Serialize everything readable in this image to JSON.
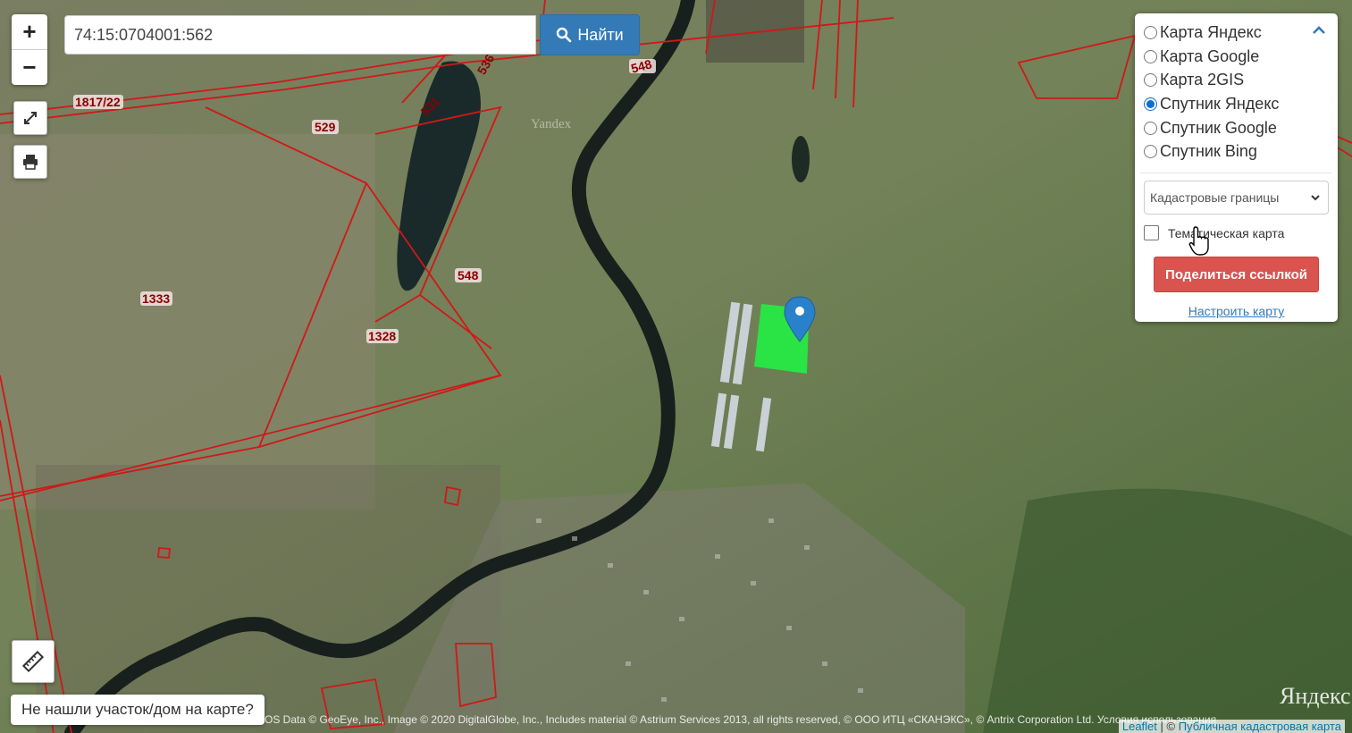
{
  "search": {
    "value": "74:15:0704001:562",
    "button_label": "Найти"
  },
  "zoom": {
    "in": "+",
    "out": "−"
  },
  "layers": {
    "options": [
      {
        "label": "Карта Яндекс",
        "selected": false
      },
      {
        "label": "Карта Google",
        "selected": false
      },
      {
        "label": "Карта 2GIS",
        "selected": false
      },
      {
        "label": "Спутник Яндекс",
        "selected": true
      },
      {
        "label": "Спутник Google",
        "selected": false
      },
      {
        "label": "Спутник Bing",
        "selected": false
      }
    ],
    "overlay_select": "Кадастровые границы",
    "thematic_label": "Тематическая карта",
    "share_label": "Поделиться ссылкой",
    "configure_label": "Настроить карту"
  },
  "not_found_label": "Не нашли участок/дом на карте?",
  "map": {
    "watermark_top": "Yandex",
    "watermark_logo": "Яндекс",
    "plot_labels": [
      "1817/22",
      "529",
      "531",
      "536",
      "548",
      "548",
      "1333",
      "1328"
    ],
    "attribution": "OS Data © GeoEye, Inc., Image © 2020 DigitalGlobe, Inc., Includes material © Astrium Services 2013, all rights reserved, © ООО ИТЦ «СКАНЭКС», © Antrix Corporation Ltd. Условия использования",
    "leaflet": "Leaflet",
    "pkk": "Публичная кадастровая карта"
  },
  "colors": {
    "accent": "#337ab7",
    "share": "#d9534f",
    "parcel_highlight": "#22ee44",
    "boundary": "#d01818",
    "marker": "#2a81cb"
  }
}
